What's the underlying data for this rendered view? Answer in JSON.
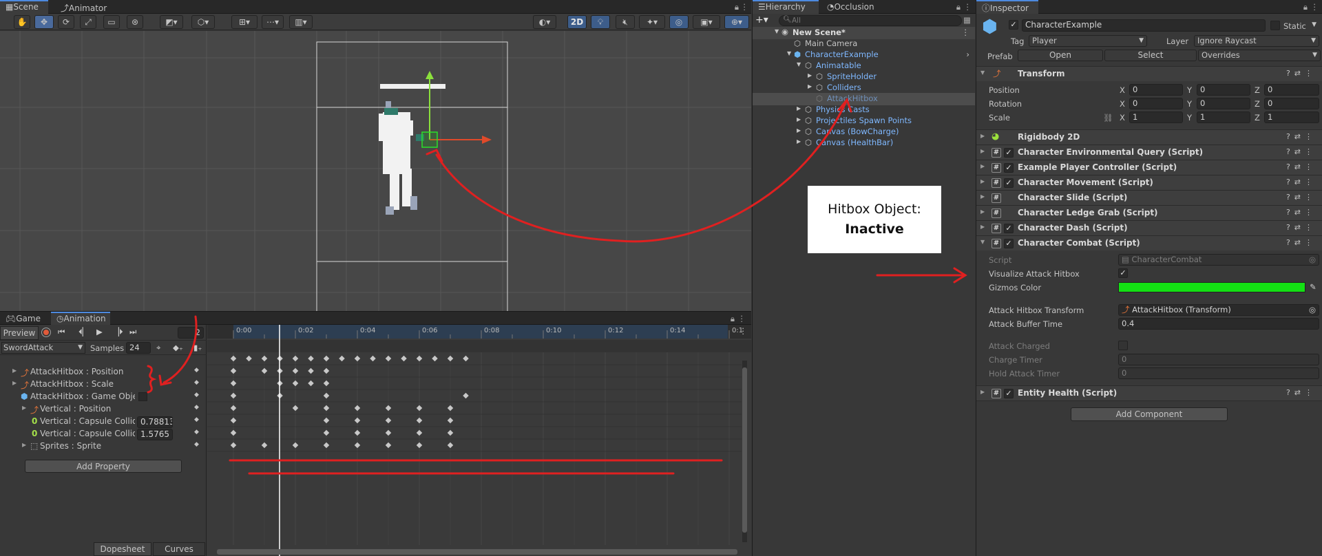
{
  "scene_panel": {
    "tabs": [
      "Scene",
      "Animator"
    ],
    "toolbar": {
      "mode_2d": "2D"
    }
  },
  "animation_panel": {
    "tabs": [
      "Game",
      "Animation"
    ],
    "preview_label": "Preview",
    "frame_value": "2",
    "clip_name": "SwordAttack",
    "samples_label": "Samples",
    "samples_value": "24",
    "timeline_ticks": [
      "0:00",
      "0:02",
      "0:04",
      "0:06",
      "0:08",
      "0:10",
      "0:12",
      "0:14",
      "0:1"
    ],
    "properties": [
      {
        "label": "AttackHitbox : Position",
        "value": ""
      },
      {
        "label": "AttackHitbox : Scale",
        "value": ""
      },
      {
        "label": "AttackHitbox : Game Object",
        "value": ""
      },
      {
        "label": "Vertical : Position",
        "value": ""
      },
      {
        "label": "Vertical : Capsule Collider",
        "value": "0.78813"
      },
      {
        "label": "Vertical : Capsule Collider",
        "value": "1.5765"
      },
      {
        "label": "Sprites : Sprite",
        "value": ""
      }
    ],
    "add_property_label": "Add Property",
    "bottom_tabs": [
      "Dopesheet",
      "Curves"
    ]
  },
  "hierarchy": {
    "tabs": [
      "Hierarchy",
      "Occlusion"
    ],
    "search_placeholder": "All",
    "items": [
      {
        "label": "New Scene*"
      },
      {
        "label": "Main Camera"
      },
      {
        "label": "CharacterExample"
      },
      {
        "label": "Animatable"
      },
      {
        "label": "SpriteHolder"
      },
      {
        "label": "Colliders"
      },
      {
        "label": "AttackHitbox"
      },
      {
        "label": "Physics Casts"
      },
      {
        "label": "Projectiles Spawn Points"
      },
      {
        "label": "Canvas (BowCharge)"
      },
      {
        "label": "Canvas (HealthBar)"
      }
    ]
  },
  "annotation": {
    "line1": "Hitbox Object:",
    "line2": "Inactive",
    "arrow_color": "#e02020"
  },
  "inspector": {
    "tab": "Inspector",
    "object_name": "CharacterExample",
    "static_label": "Static",
    "tag_label": "Tag",
    "tag_value": "Player",
    "layer_label": "Layer",
    "layer_value": "Ignore Raycast",
    "prefab_label": "Prefab",
    "prefab_open": "Open",
    "prefab_select": "Select",
    "prefab_overrides": "Overrides",
    "transform": {
      "title": "Transform",
      "position_label": "Position",
      "rotation_label": "Rotation",
      "scale_label": "Scale",
      "position": [
        "0",
        "0",
        "0"
      ],
      "rotation": [
        "0",
        "0",
        "0"
      ],
      "scale": [
        "1",
        "1",
        "1"
      ],
      "axes": [
        "X",
        "Y",
        "Z"
      ]
    },
    "components": [
      "Rigidbody 2D",
      "Character Environmental Query (Script)",
      "Example Player Controller (Script)",
      "Character Movement (Script)",
      "Character Slide (Script)",
      "Character Ledge Grab (Script)",
      "Character Dash (Script)",
      "Character Combat (Script)"
    ],
    "combat": {
      "script_label": "Script",
      "script_value": "CharacterCombat",
      "visualize_label": "Visualize Attack Hitbox",
      "gizmos_label": "Gizmos Color",
      "gizmos_color": "#14e014",
      "hitbox_transform_label": "Attack Hitbox Transform",
      "hitbox_transform_value": "AttackHitbox (Transform)",
      "buffer_label": "Attack Buffer Time",
      "buffer_value": "0.4",
      "charged_label": "Attack Charged",
      "charge_timer_label": "Charge Timer",
      "charge_timer_value": "0",
      "hold_timer_label": "Hold Attack Timer",
      "hold_timer_value": "0"
    },
    "entity_health": "Entity Health (Script)",
    "add_component": "Add Component"
  }
}
